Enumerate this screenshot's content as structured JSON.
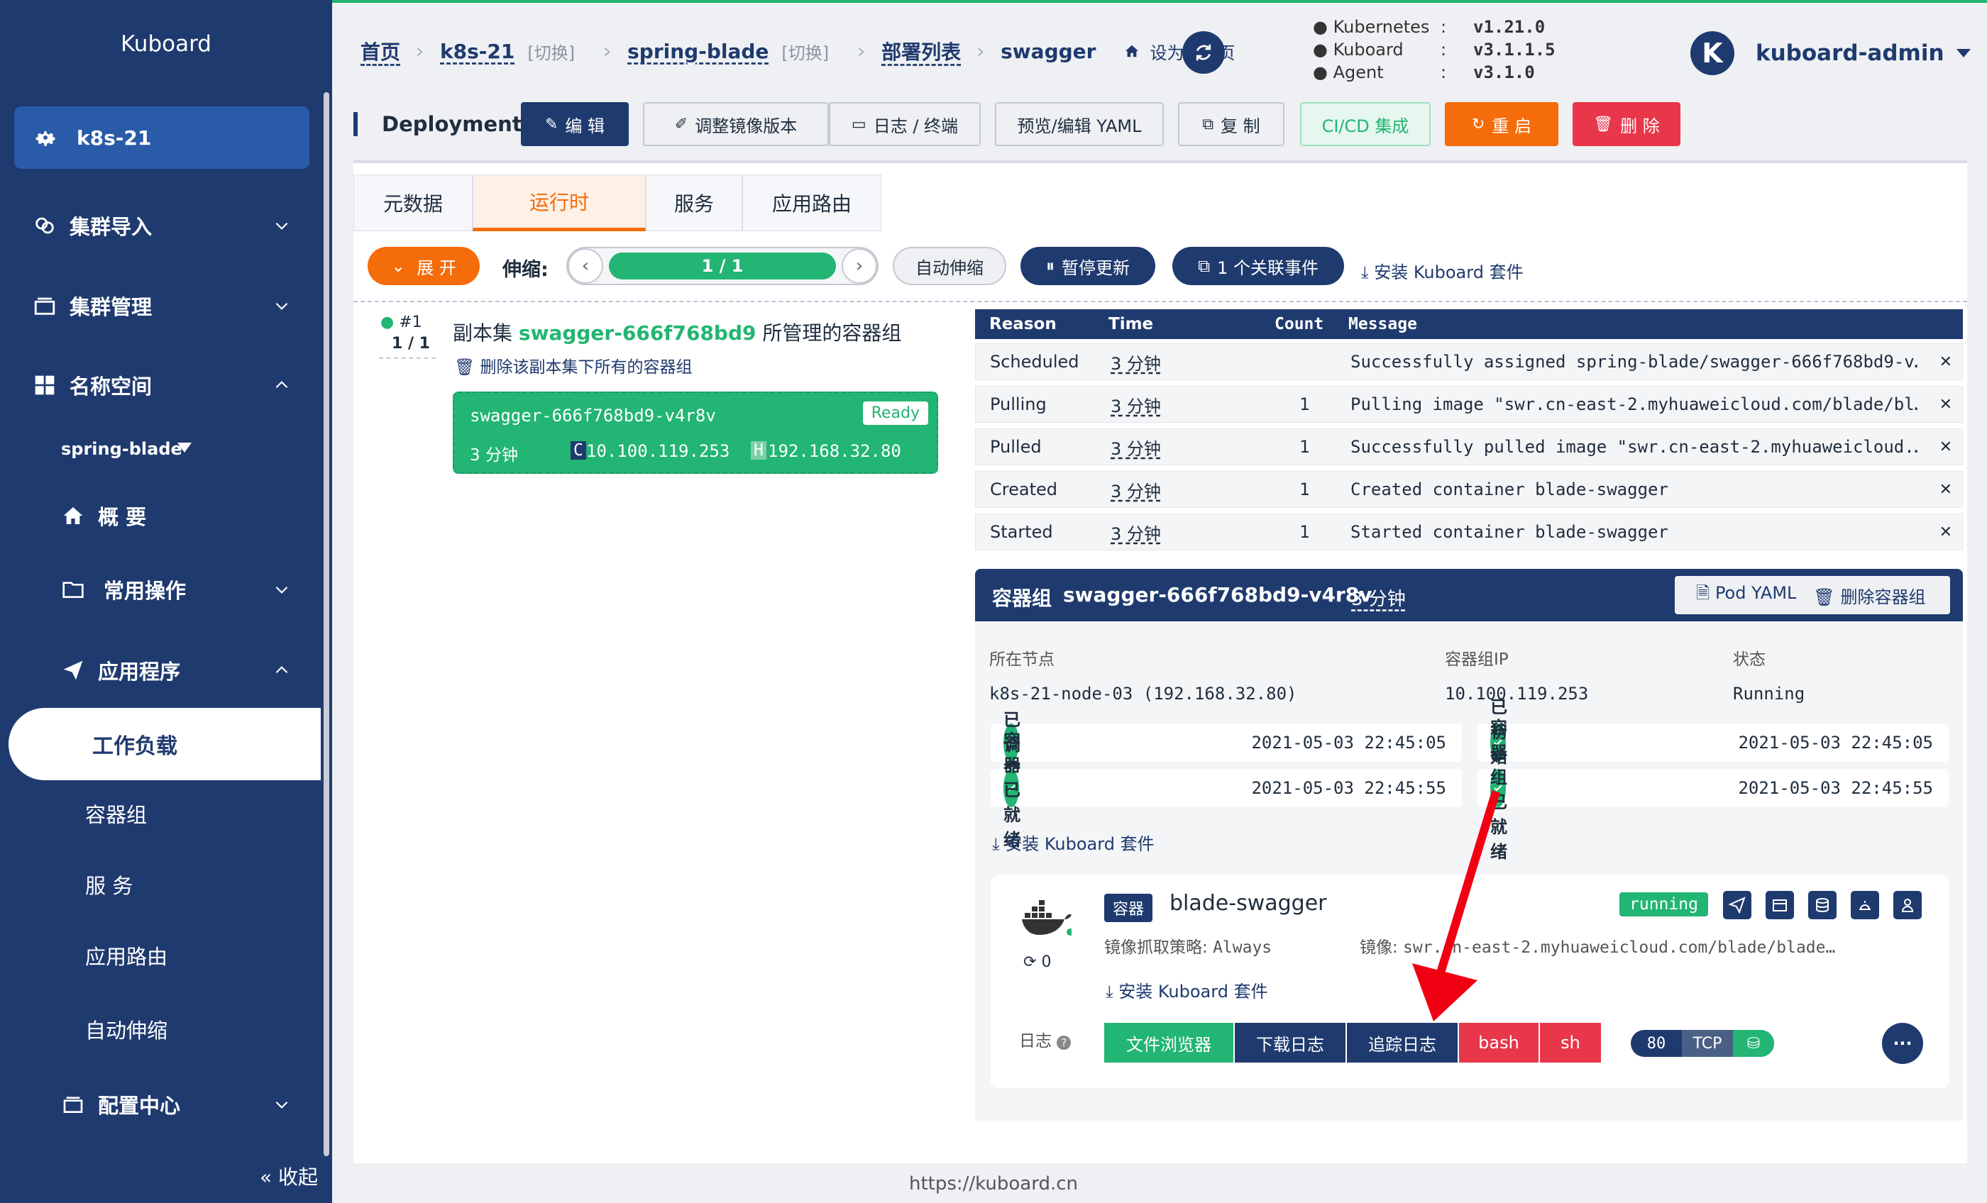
{
  "sidebar": {
    "title": "Kuboard",
    "cluster": "k8s-21",
    "items": {
      "cluster_import": "集群导入",
      "cluster_manage": "集群管理",
      "namespace": "名称空间",
      "namespace_value": "spring-blade",
      "overview": "概 要",
      "common_ops": "常用操作",
      "apps": "应用程序",
      "workloads": "工作负载",
      "pods": "容器组",
      "services": "服 务",
      "ingress": "应用路由",
      "autoscale": "自动伸缩",
      "config": "配置中心"
    },
    "collapse": "收起"
  },
  "breadcrumb": {
    "home": "首页",
    "cluster": "k8s-21",
    "switch1": "[切换]",
    "namespace": "spring-blade",
    "switch2": "[切换]",
    "deploy_list": "部署列表",
    "current": "swagger",
    "set_default": "设为默认页"
  },
  "versions": {
    "rows": [
      {
        "k": "Kubernetes",
        "v": "v1.21.0"
      },
      {
        "k": "Kuboard",
        "v": "v3.1.1.5"
      },
      {
        "k": "Agent",
        "v": "v3.1.0"
      }
    ]
  },
  "user": {
    "initial": "K",
    "name": "kuboard-admin"
  },
  "actionbar": {
    "kind": "Deployment",
    "edit": "编 辑",
    "adjust_image": "调整镜像版本",
    "logs": "日志 / 终端",
    "yaml": "预览/编辑 YAML",
    "copy": "复 制",
    "cicd": "CI/CD 集成",
    "restart": "重 启",
    "delete": "删 除"
  },
  "tabs": [
    "元数据",
    "运行时",
    "服务",
    "应用路由"
  ],
  "controls": {
    "expand": "展 开",
    "scale_label": "伸缩:",
    "scale_value": "1 / 1",
    "autoscale": "自动伸缩",
    "pause": "暂停更新",
    "events": "1 个关联事件",
    "install": "安装 Kuboard 套件"
  },
  "replicaset": {
    "index": "#1",
    "ratio": "1 / 1",
    "prefix": "副本集",
    "name": "swagger-666f768bd9",
    "suffix": "所管理的容器组",
    "delete_all": "删除该副本集下所有的容器组",
    "pod_name": "swagger-666f768bd9-v4r8v",
    "pod_status": "Ready",
    "pod_age": "3 分钟",
    "c_tag": "C",
    "pod_ip": "10.100.119.253",
    "h_tag": "H",
    "host_ip": "192.168.32.80"
  },
  "events": {
    "headers": {
      "reason": "Reason",
      "time": "Time",
      "count": "Count",
      "message": "Message"
    },
    "rows": [
      {
        "reason": "Scheduled",
        "time": "3 分钟",
        "count": "",
        "message": "Successfully assigned spring-blade/swagger-666f768bd9-v…"
      },
      {
        "reason": "Pulling",
        "time": "3 分钟",
        "count": "1",
        "message": "Pulling image \"swr.cn-east-2.myhuaweicloud.com/blade/bl…"
      },
      {
        "reason": "Pulled",
        "time": "3 分钟",
        "count": "1",
        "message": "Successfully pulled image \"swr.cn-east-2.myhuaweicloud.…"
      },
      {
        "reason": "Created",
        "time": "3 分钟",
        "count": "1",
        "message": "Created container blade-swagger"
      },
      {
        "reason": "Started",
        "time": "3 分钟",
        "count": "1",
        "message": "Started container blade-swagger"
      }
    ]
  },
  "pod": {
    "label": "容器组",
    "name": "swagger-666f768bd9-v4r8v",
    "age": "3 分钟",
    "pod_yaml": "Pod YAML",
    "delete": "删除容器组",
    "node_label": "所在节点",
    "node_value": "k8s-21-node-03 (192.168.32.80)",
    "ip_label": "容器组IP",
    "ip_value": "10.100.119.253",
    "status_label": "状态",
    "status_value": "Running",
    "conditions": [
      {
        "label": "已调度",
        "time": "2021-05-03 22:45:05"
      },
      {
        "label": "已初始化",
        "time": "2021-05-03 22:45:05"
      },
      {
        "label": "容器已就绪",
        "time": "2021-05-03 22:45:55"
      },
      {
        "label": "容器组已就绪",
        "time": "2021-05-03 22:45:55"
      }
    ],
    "install": "安装 Kuboard 套件"
  },
  "container": {
    "tag": "容器",
    "name": "blade-swagger",
    "state": "running",
    "pull_policy_label": "镜像抓取策略:",
    "pull_policy": "Always",
    "image_label": "镜像:",
    "image": "swr.cn-east-2.myhuaweicloud.com/blade/blade…",
    "restarts": "0",
    "install": "安装 Kuboard 套件",
    "log_label": "日志",
    "buttons": {
      "files": "文件浏览器",
      "download": "下载日志",
      "follow": "追踪日志",
      "bash": "bash",
      "sh": "sh"
    },
    "port": "80",
    "protocol": "TCP",
    "more": "···"
  },
  "footer": "https://kuboard.cn",
  "colors": {
    "navy": "#1f3a6e",
    "green": "#22b573",
    "orange": "#f56c0a",
    "red": "#e8364a"
  }
}
